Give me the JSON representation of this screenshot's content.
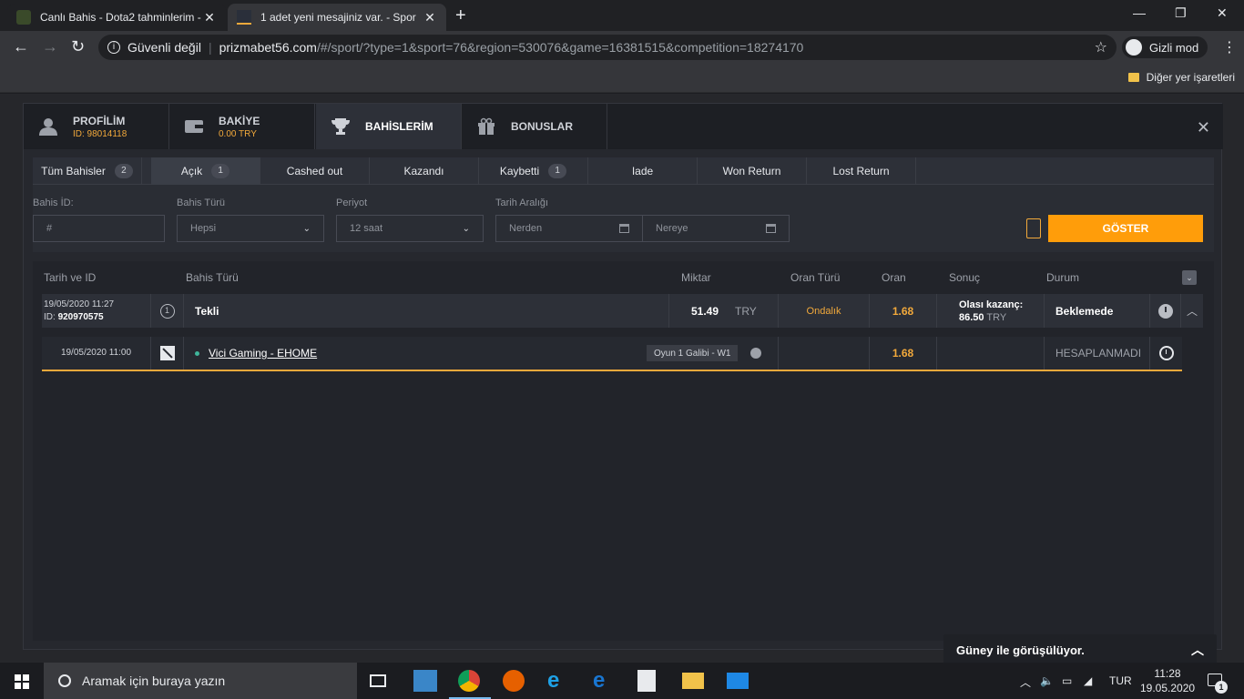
{
  "browser": {
    "tabs": [
      {
        "title": "Canlı Bahis - Dota2 tahminlerim -",
        "active": false
      },
      {
        "title": "1 adet yeni mesajiniz var. - Spor",
        "active": true
      }
    ],
    "address": {
      "security_label": "Güvenli değil",
      "host": "prizmabet56.com",
      "path": "/#/sport/?type=1&sport=76&region=530076&game=16381515&competition=18274170"
    },
    "incognito_label": "Gizli mod",
    "bookmarks_label": "Diğer yer işaretleri"
  },
  "modal": {
    "tabs": [
      {
        "label": "PROFİLİM",
        "sub": "ID: 98014118",
        "icon": "user-icon"
      },
      {
        "label": "BAKİYE",
        "sub": "0.00 TRY",
        "icon": "wallet-icon"
      },
      {
        "label": "BAHİSLERİM",
        "sub": "",
        "icon": "trophy-icon"
      },
      {
        "label": "BONUSLAR",
        "sub": "",
        "icon": "gift-icon"
      }
    ],
    "active_tab": "BAHİSLERİM",
    "subtabs": [
      {
        "label": "Tüm Bahisler",
        "count": "2"
      },
      {
        "label": "Açık",
        "count": "1"
      },
      {
        "label": "Cashed out",
        "count": ""
      },
      {
        "label": "Kazandı",
        "count": ""
      },
      {
        "label": "Kaybetti",
        "count": "1"
      },
      {
        "label": "Iade",
        "count": ""
      },
      {
        "label": "Won Return",
        "count": ""
      },
      {
        "label": "Lost Return",
        "count": ""
      }
    ],
    "active_subtab": "Açık",
    "filters": {
      "bet_id_label": "Bahis İD:",
      "bet_id_placeholder": "#",
      "bet_type_label": "Bahis Türü",
      "bet_type_value": "Hepsi",
      "period_label": "Periyot",
      "period_value": "12 saat",
      "date_range_label": "Tarih Aralığı",
      "from_placeholder": "Nerden",
      "to_placeholder": "Nereye",
      "show_button": "GÖSTER"
    },
    "table": {
      "headers": [
        "Tarih ve ID",
        "Bahis Türü",
        "Miktar",
        "Oran Türü",
        "Oran",
        "Sonuç",
        "Durum"
      ],
      "bet": {
        "datetime": "19/05/2020 11:27",
        "id_label": "ID:",
        "id": "920970575",
        "type_number": "1",
        "type": "Tekli",
        "amount": "51.49",
        "currency": "TRY",
        "odds_type": "Ondalık",
        "odds": "1.68",
        "result_label": "Olası kazanç:",
        "result_amount": "86.50",
        "result_currency": "TRY",
        "status": "Beklemede"
      },
      "selection": {
        "datetime": "19/05/2020 11:00",
        "match": "Vici Gaming - EHOME",
        "market": "Oyun 1 Galibi - W1",
        "odds": "1.68",
        "status": "HESAPLANMADI"
      }
    }
  },
  "toast": {
    "text": "Güney ile görüşülüyor."
  },
  "taskbar": {
    "search_placeholder": "Aramak için buraya yazın",
    "language": "TUR",
    "time": "11:28",
    "date": "19.05.2020",
    "notification_count": "1"
  },
  "colors": {
    "accent": "#ff9d0a",
    "odds": "#f2a93b",
    "panel": "#26282e"
  }
}
